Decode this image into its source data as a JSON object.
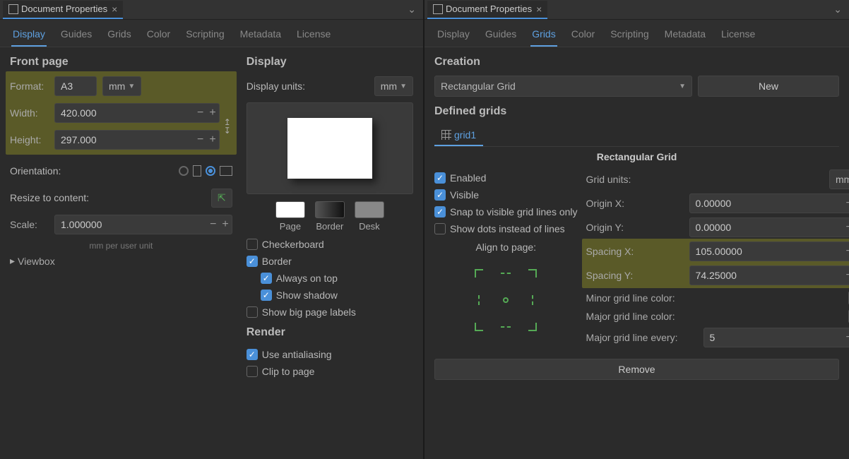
{
  "left": {
    "title": "Document Properties",
    "tabs": [
      "Display",
      "Guides",
      "Grids",
      "Color",
      "Scripting",
      "Metadata",
      "License"
    ],
    "active_tab": "Display",
    "front_page": {
      "heading": "Front page",
      "format_label": "Format:",
      "format_value": "A3",
      "format_units": "mm",
      "width_label": "Width:",
      "width_value": "420.000",
      "height_label": "Height:",
      "height_value": "297.000",
      "orientation_label": "Orientation:",
      "resize_label": "Resize to content:",
      "scale_label": "Scale:",
      "scale_value": "1.000000",
      "scale_hint": "mm per user unit",
      "viewbox_label": "Viewbox"
    },
    "display": {
      "heading": "Display",
      "units_label": "Display units:",
      "units_value": "mm",
      "swatches": {
        "page": "Page",
        "border": "Border",
        "desk": "Desk"
      },
      "checkerboard": "Checkerboard",
      "border": "Border",
      "always_on_top": "Always on top",
      "show_shadow": "Show shadow",
      "show_big_labels": "Show big page labels",
      "render_heading": "Render",
      "use_aa": "Use antialiasing",
      "clip": "Clip to page"
    }
  },
  "right": {
    "title": "Document Properties",
    "tabs": [
      "Display",
      "Guides",
      "Grids",
      "Color",
      "Scripting",
      "Metadata",
      "License"
    ],
    "active_tab": "Grids",
    "creation_heading": "Creation",
    "grid_type": "Rectangular Grid",
    "new_label": "New",
    "defined_heading": "Defined grids",
    "grid_tab": "grid1",
    "grid_title": "Rectangular Grid",
    "enabled": "Enabled",
    "visible": "Visible",
    "snap_visible": "Snap to visible grid lines only",
    "show_dots": "Show dots instead of lines",
    "align_label": "Align to page:",
    "grid_units_label": "Grid units:",
    "grid_units_value": "mm",
    "origin_x_label": "Origin X:",
    "origin_x_value": "0.00000",
    "origin_y_label": "Origin Y:",
    "origin_y_value": "0.00000",
    "spacing_x_label": "Spacing X:",
    "spacing_x_value": "105.00000",
    "spacing_y_label": "Spacing Y:",
    "spacing_y_value": "74.25000",
    "minor_color_label": "Minor grid line color:",
    "major_color_label": "Major grid line color:",
    "major_every_label": "Major grid line every:",
    "major_every_value": "5",
    "remove_label": "Remove"
  }
}
